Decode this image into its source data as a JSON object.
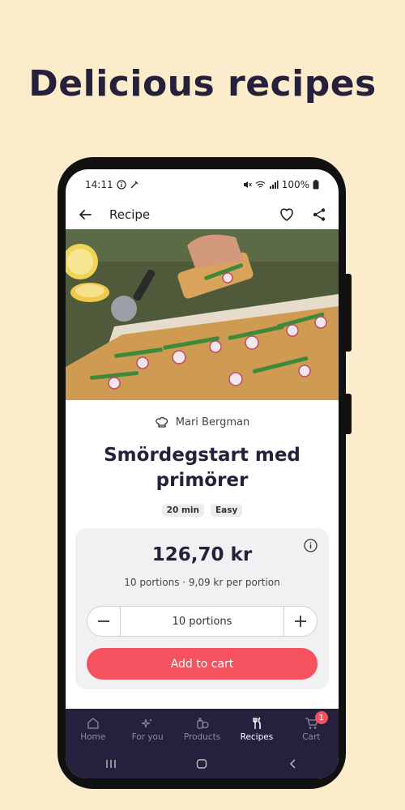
{
  "headline": "Delicious recipes",
  "status": {
    "time": "14:11",
    "battery": "100%"
  },
  "appbar": {
    "title": "Recipe",
    "back_icon": "arrow-left-icon",
    "favorite_icon": "heart-icon",
    "share_icon": "share-icon"
  },
  "recipe": {
    "author": "Mari Bergman",
    "title": "Smördegstart med primörer",
    "tags": [
      "20 min",
      "Easy"
    ]
  },
  "pricing": {
    "price": "126,70 kr",
    "description": "10 portions · 9,09 kr per portion",
    "portions_label": "10 portions",
    "add_to_cart": "Add to cart"
  },
  "nav": {
    "items": [
      {
        "label": "Home",
        "icon": "home-icon"
      },
      {
        "label": "For you",
        "icon": "sparkle-icon"
      },
      {
        "label": "Products",
        "icon": "products-icon"
      },
      {
        "label": "Recipes",
        "icon": "fork-knife-icon"
      },
      {
        "label": "Cart",
        "icon": "cart-icon"
      }
    ],
    "active": "Recipes",
    "cart_badge": "1"
  },
  "colors": {
    "accent": "#f4525e",
    "navy": "#25213c",
    "background": "#fdeccb"
  }
}
